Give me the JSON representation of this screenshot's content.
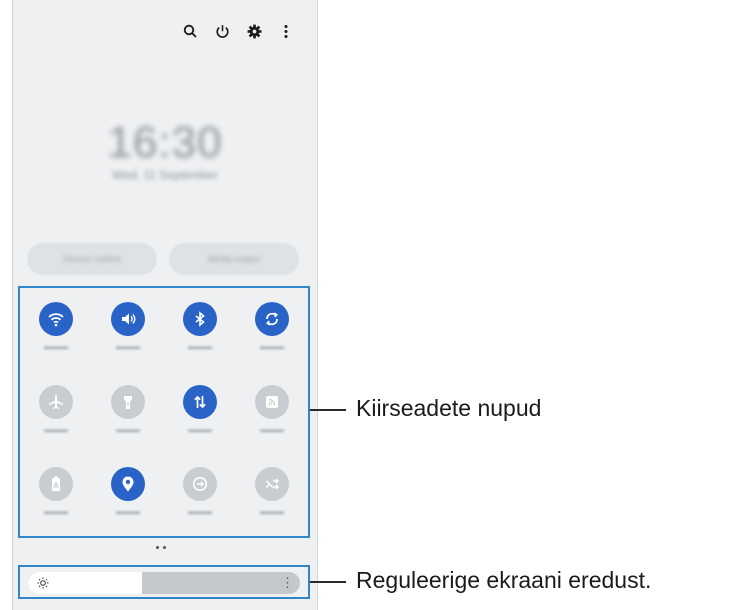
{
  "top_icons": [
    "search-icon",
    "power-icon",
    "gear-icon",
    "more-vertical-icon"
  ],
  "callouts": {
    "quick_settings": "Kiirseadete nupud",
    "brightness": "Reguleerige ekraani eredust."
  },
  "brightness": {
    "level": 0.42
  },
  "tiles": [
    {
      "icon": "wifi-icon",
      "state": "on"
    },
    {
      "icon": "sound-icon",
      "state": "on"
    },
    {
      "icon": "bluetooth-icon",
      "state": "on"
    },
    {
      "icon": "auto-rotate-icon",
      "state": "on"
    },
    {
      "icon": "airplane-icon",
      "state": "off"
    },
    {
      "icon": "flashlight-icon",
      "state": "off"
    },
    {
      "icon": "mobile-data-icon",
      "state": "on"
    },
    {
      "icon": "cast-icon",
      "state": "off"
    },
    {
      "icon": "power-saving-icon",
      "state": "off"
    },
    {
      "icon": "location-icon",
      "state": "on"
    },
    {
      "icon": "sync-icon",
      "state": "off"
    },
    {
      "icon": "shuffle-icon",
      "state": "off"
    }
  ],
  "colors": {
    "active": "#2a63c7",
    "inactive": "#c9cdd1",
    "highlight": "#2f86c8"
  }
}
